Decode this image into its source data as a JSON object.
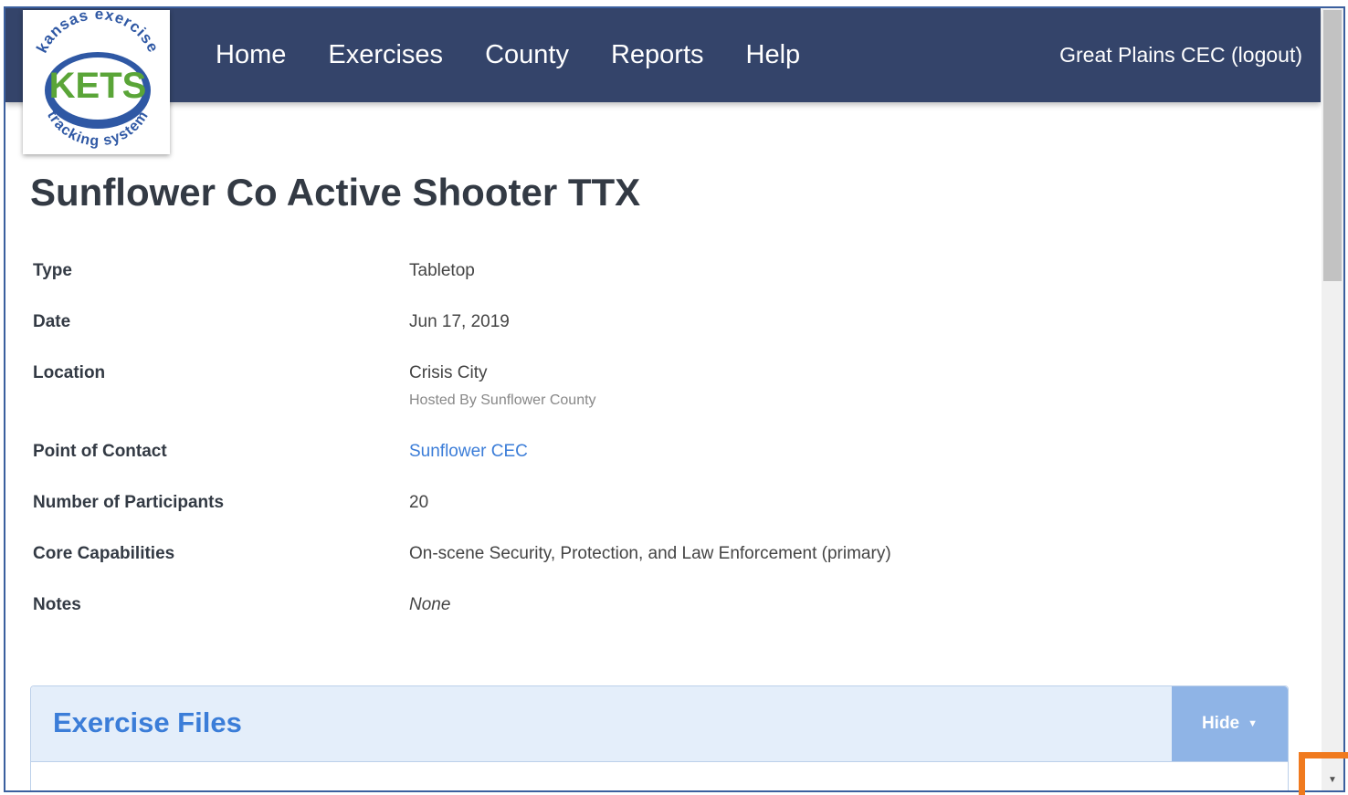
{
  "logo": {
    "arc_top": "kansas exercise",
    "name": "KETS",
    "arc_bottom": "tracking system",
    "colors": {
      "green": "#5aa538",
      "blue": "#2f58a4"
    }
  },
  "nav": {
    "items": [
      "Home",
      "Exercises",
      "County",
      "Reports",
      "Help"
    ],
    "user": "Great Plains CEC (logout)"
  },
  "page": {
    "title": "Sunflower Co Active Shooter TTX"
  },
  "details": {
    "type": {
      "label": "Type",
      "value": "Tabletop"
    },
    "date": {
      "label": "Date",
      "value": "Jun 17, 2019"
    },
    "location": {
      "label": "Location",
      "value": "Crisis City",
      "sub": "Hosted By Sunflower County"
    },
    "contact": {
      "label": "Point of Contact",
      "value": "Sunflower CEC"
    },
    "participants": {
      "label": "Number of Participants",
      "value": "20"
    },
    "capabilities": {
      "label": "Core Capabilities",
      "value": "On-scene Security, Protection, and Law Enforcement (primary)"
    },
    "notes": {
      "label": "Notes",
      "value": "None"
    }
  },
  "files_panel": {
    "title": "Exercise Files",
    "toggle_label": "Hide"
  },
  "colors": {
    "navbar": "#34446a",
    "link": "#3b7dd8",
    "panel_header": "#e4eefa",
    "hide_button": "#8fb4e6",
    "highlight": "#f07a1e"
  }
}
